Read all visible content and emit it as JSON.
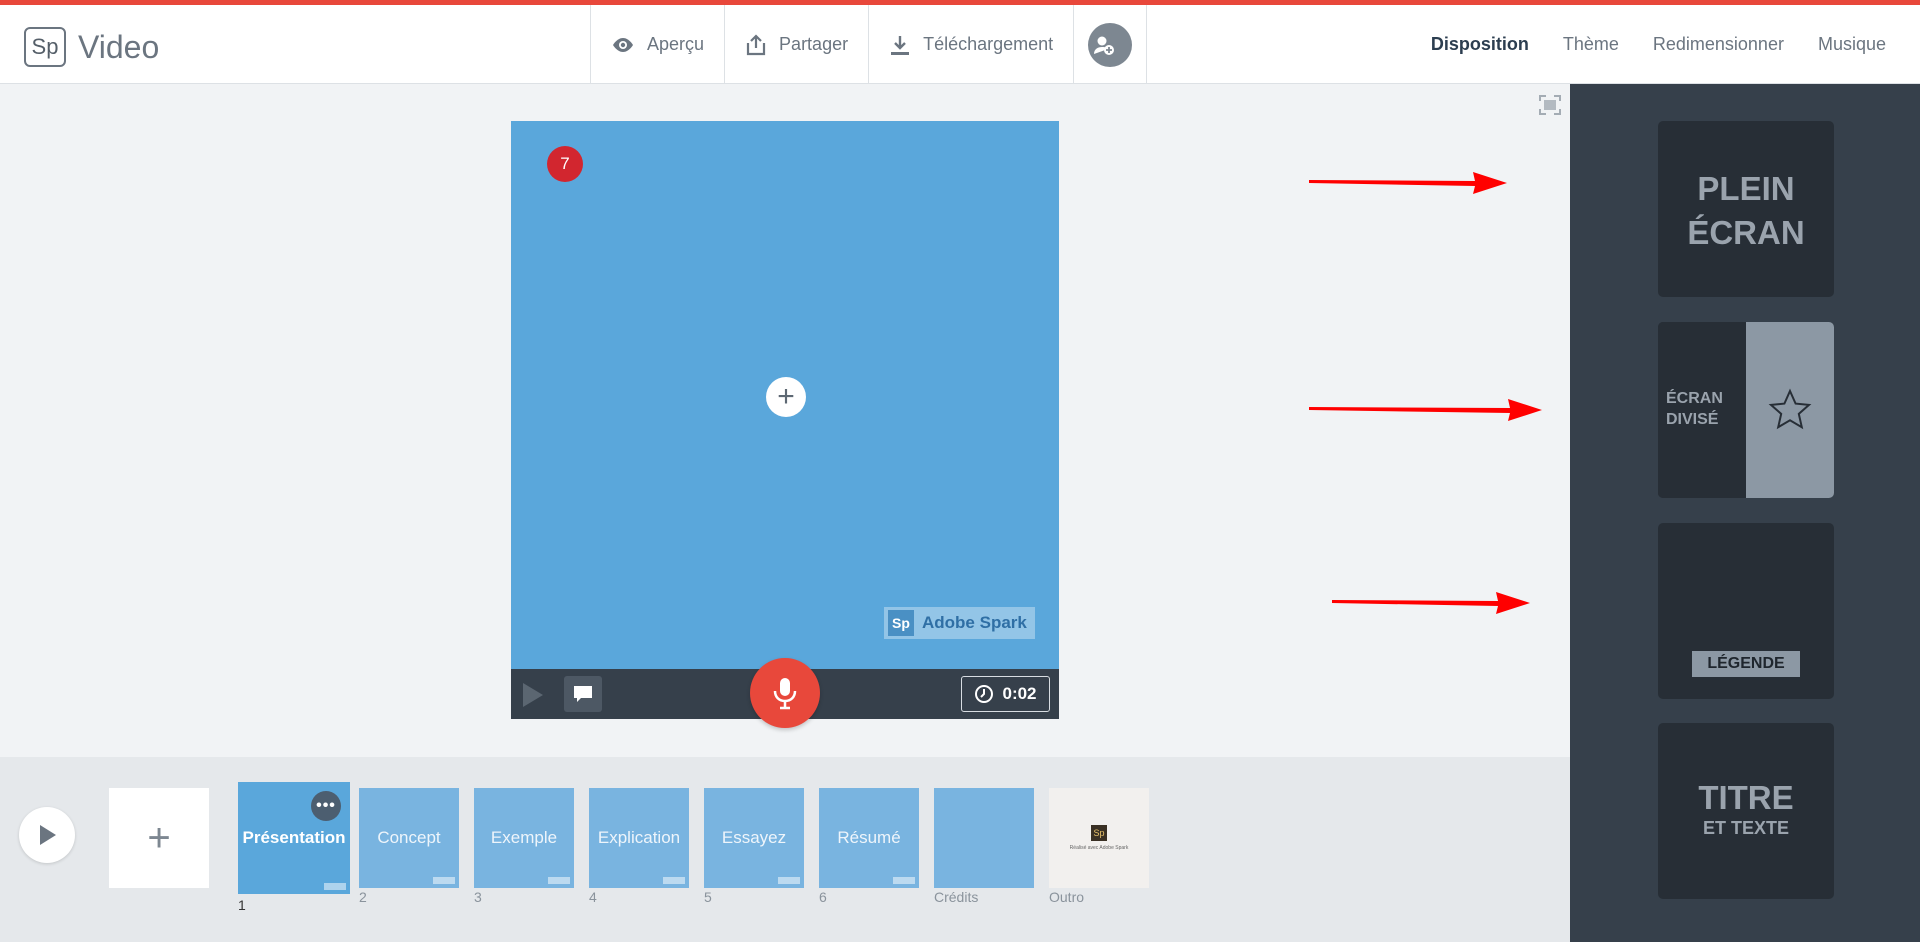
{
  "header": {
    "logo_mark": "Sp",
    "app_name": "Video",
    "tools": [
      {
        "label": "Aperçu",
        "icon": "eye-icon"
      },
      {
        "label": "Partager",
        "icon": "share-icon"
      },
      {
        "label": "Téléchargement",
        "icon": "download-icon"
      }
    ],
    "nav": [
      "Disposition",
      "Thème",
      "Redimensionner",
      "Musique"
    ],
    "active_nav": "Disposition"
  },
  "layouts": [
    {
      "name": "full-screen",
      "lines": [
        "PLEIN",
        "ÉCRAN"
      ]
    },
    {
      "name": "split-screen",
      "lines": [
        "ÉCRAN",
        "DIVISÉ"
      ]
    },
    {
      "name": "caption",
      "label": "LÉGENDE"
    },
    {
      "name": "title-text",
      "lines": [
        "TITRE",
        "ET TEXTE"
      ]
    }
  ],
  "stage": {
    "badge": "7",
    "watermark_mark": "Sp",
    "watermark_text": "Adobe Spark",
    "duration": "0:02",
    "background_color": "#5aa7db"
  },
  "timeline": {
    "slides": [
      {
        "label": "Présentation",
        "number": "1"
      },
      {
        "label": "Concept",
        "number": "2"
      },
      {
        "label": "Exemple",
        "number": "3"
      },
      {
        "label": "Explication",
        "number": "4"
      },
      {
        "label": "Essayez",
        "number": "5"
      },
      {
        "label": "Résumé",
        "number": "6"
      },
      {
        "label": "",
        "number": "Crédits"
      },
      {
        "label": "",
        "number": "Outro",
        "outro_mark": "Sp",
        "outro_text": "Réalisé avec Adobe Spark"
      }
    ]
  },
  "colors": {
    "accent": "#e8483b",
    "panel": "#36404b",
    "slide_active": "#5aa7db",
    "slide": "#79b4e0",
    "arrow": "#ff0000"
  }
}
